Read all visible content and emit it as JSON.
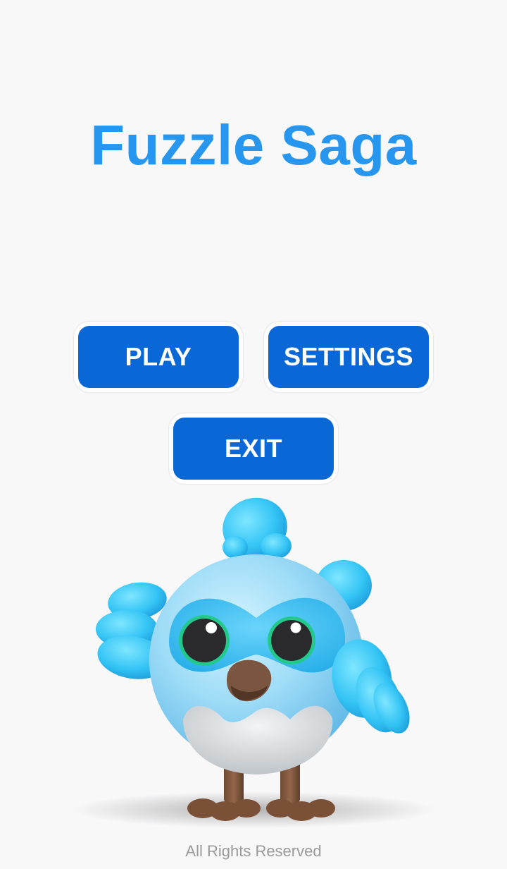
{
  "game_title": "Fuzzle Saga",
  "menu": {
    "play_label": "PLAY",
    "settings_label": "SETTINGS",
    "exit_label": "EXIT"
  },
  "mascot": {
    "icon": "blue-bird-mascot-icon"
  },
  "footer": {
    "text": "All Rights Reserved"
  },
  "colors": {
    "title": "#2696ee",
    "button": "#0a67d6",
    "button_text": "#ffffff",
    "background": "#f8f8f9",
    "footer_text": "#9a9a9a"
  }
}
